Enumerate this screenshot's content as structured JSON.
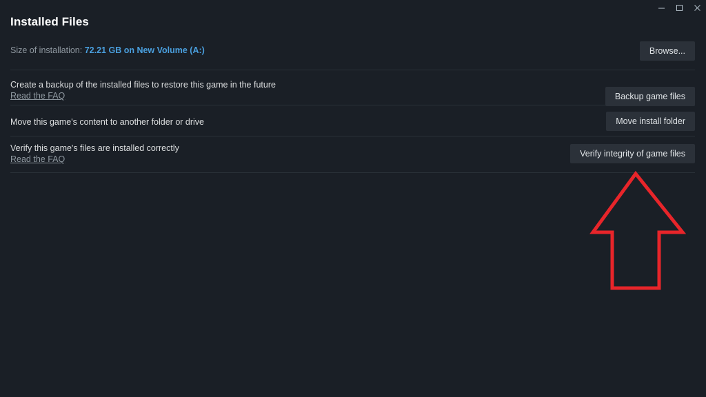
{
  "window": {
    "controls": [
      {
        "name": "minimize",
        "glyph": "minimize-icon"
      },
      {
        "name": "maximize",
        "glyph": "maximize-icon"
      },
      {
        "name": "close",
        "glyph": "close-icon"
      }
    ]
  },
  "page": {
    "title": "Installed Files"
  },
  "size_row": {
    "label": "Size of installation:",
    "value": "72.21 GB on New Volume (A:)",
    "value_color": "#4a9fde"
  },
  "rows": [
    {
      "id": "backup",
      "description": "Create a backup of the installed files to restore this game in the future",
      "faq_label": "Read the FAQ",
      "button_label": "Backup game files"
    },
    {
      "id": "move",
      "description": "Move this game's content to another folder or drive",
      "faq_label": "",
      "button_label": "Move install folder"
    },
    {
      "id": "verify",
      "description": "Verify this game's files are installed correctly",
      "faq_label": "Read the FAQ",
      "button_label": "Verify integrity of game files"
    }
  ],
  "browse_button": {
    "label": "Browse..."
  },
  "annotation": {
    "shape": "up-arrow",
    "color": "#e8252a",
    "points_to": "Verify integrity of game files"
  },
  "colors": {
    "background": "#1a1f26",
    "button_fill": "#2b3139",
    "separator": "#2a3138",
    "text_primary": "#dcdedf",
    "text_muted": "#8f98a0",
    "link": "#4a9fde",
    "annotation_red": "#e8252a"
  }
}
